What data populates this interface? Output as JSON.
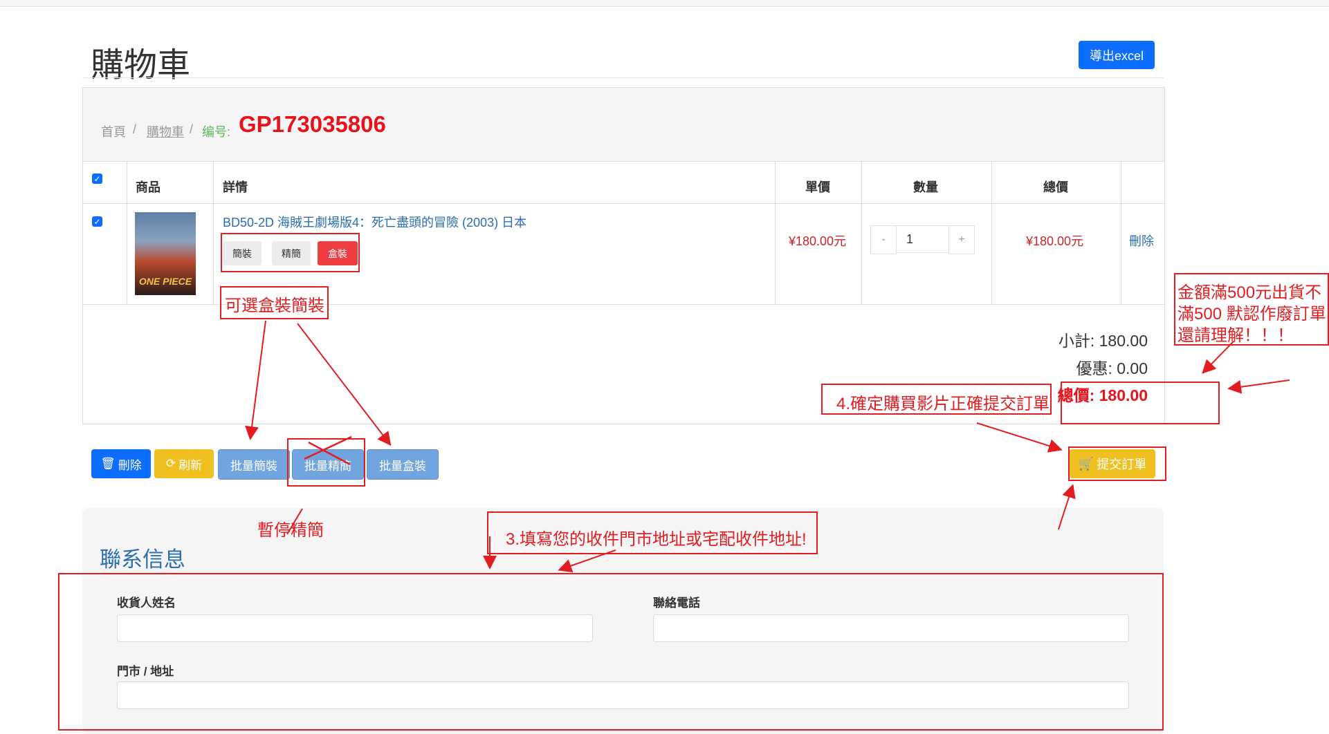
{
  "header": {
    "title": "購物車",
    "export_label": "導出excel"
  },
  "breadcrumb": {
    "home": "首頁",
    "separator": "/",
    "cart": "購物車",
    "order_label": "编号:",
    "order_number": "GP173035806"
  },
  "table": {
    "columns": [
      "商品",
      "詳情",
      "單價",
      "數量",
      "總價"
    ],
    "rows": [
      {
        "checked": true,
        "title": "BD50-2D 海賊王劇場版4：死亡盡頭的冒險 (2003) 日本",
        "poster_text": "ONE PIECE",
        "options": [
          "簡裝",
          "精簡",
          "盒裝"
        ],
        "selected_option": "盒裝",
        "unit_price": "¥180.00元",
        "quantity": "1",
        "qty_minus": "-",
        "qty_plus": "+",
        "total_price": "¥180.00元",
        "delete_label": "刪除"
      }
    ]
  },
  "summary": {
    "subtotal_label": "小計:",
    "subtotal": "180.00",
    "discount_label": "優惠:",
    "discount": "0.00",
    "total_label": "總價:",
    "total": "180.00"
  },
  "actions": {
    "delete": "刪除",
    "refresh": "刷新",
    "batch_simple": "批量簡裝",
    "batch_lite": "批量精簡",
    "batch_box": "批量盒裝",
    "submit": "提交訂單"
  },
  "contact": {
    "title": "聯系信息",
    "name_label": "收貨人姓名",
    "name_value": "",
    "phone_label": "聯絡電話",
    "phone_value": "",
    "address_label": "門市 / 地址",
    "address_value": ""
  },
  "annotations": {
    "option_note": "可選盒裝簡裝",
    "paused_note": "暫停精簡",
    "address_note": "3.填寫您的收件門市地址或宅配收件地址!",
    "confirm_note": "4.確定購買影片正確提交訂單",
    "min_amount_note": [
      "金額滿500元出貨不",
      "滿500 默認作廢訂單",
      "還請理解！！！"
    ]
  },
  "colors": {
    "primary": "#0d6efd",
    "warning": "#f0c020",
    "accent_red": "#e8121a",
    "annotation_red": "#e11d22"
  }
}
